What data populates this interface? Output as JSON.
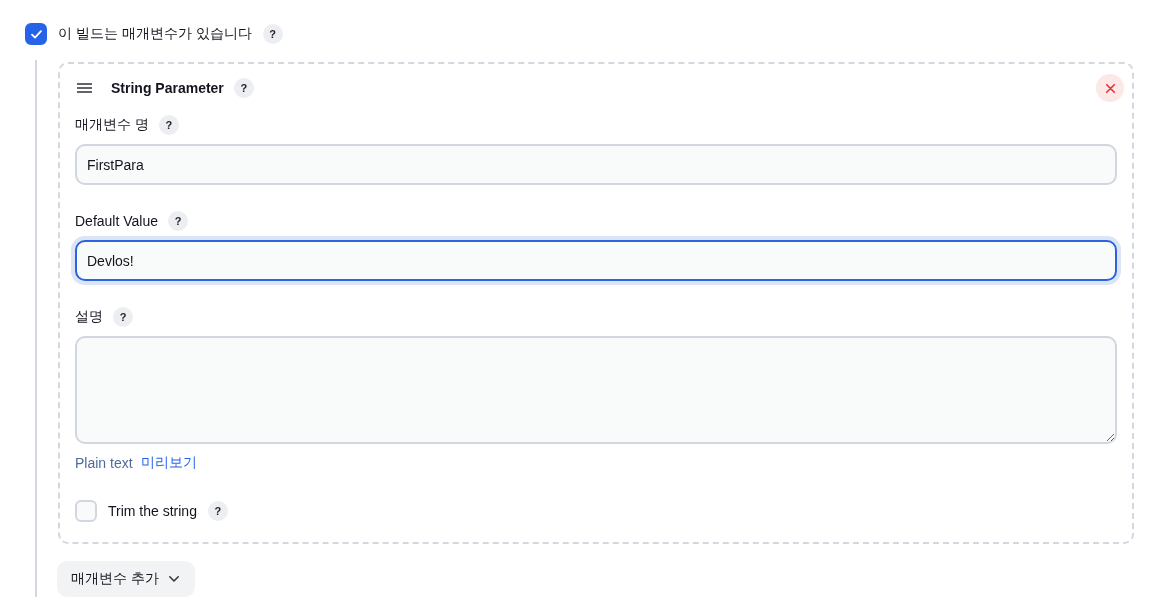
{
  "parameterized": {
    "label": "이 빌드는 매개변수가 있습니다",
    "checked": true,
    "help": "?"
  },
  "parameter": {
    "title": "String Parameter",
    "help": "?",
    "fields": [
      {
        "kind": "input",
        "label": "매개변수 명",
        "help": "?",
        "value": "FirstPara",
        "focused": false
      },
      {
        "kind": "input",
        "label": "Default Value",
        "help": "?",
        "value": "Devlos!",
        "focused": true
      },
      {
        "kind": "textarea",
        "label": "설명",
        "help": "?",
        "focused": false
      }
    ],
    "format": {
      "label": "Plain text",
      "preview_link": "미리보기"
    },
    "trim": {
      "label": "Trim the string",
      "checked": false,
      "help": "?"
    }
  },
  "add_button": {
    "label": "매개변수 추가"
  }
}
